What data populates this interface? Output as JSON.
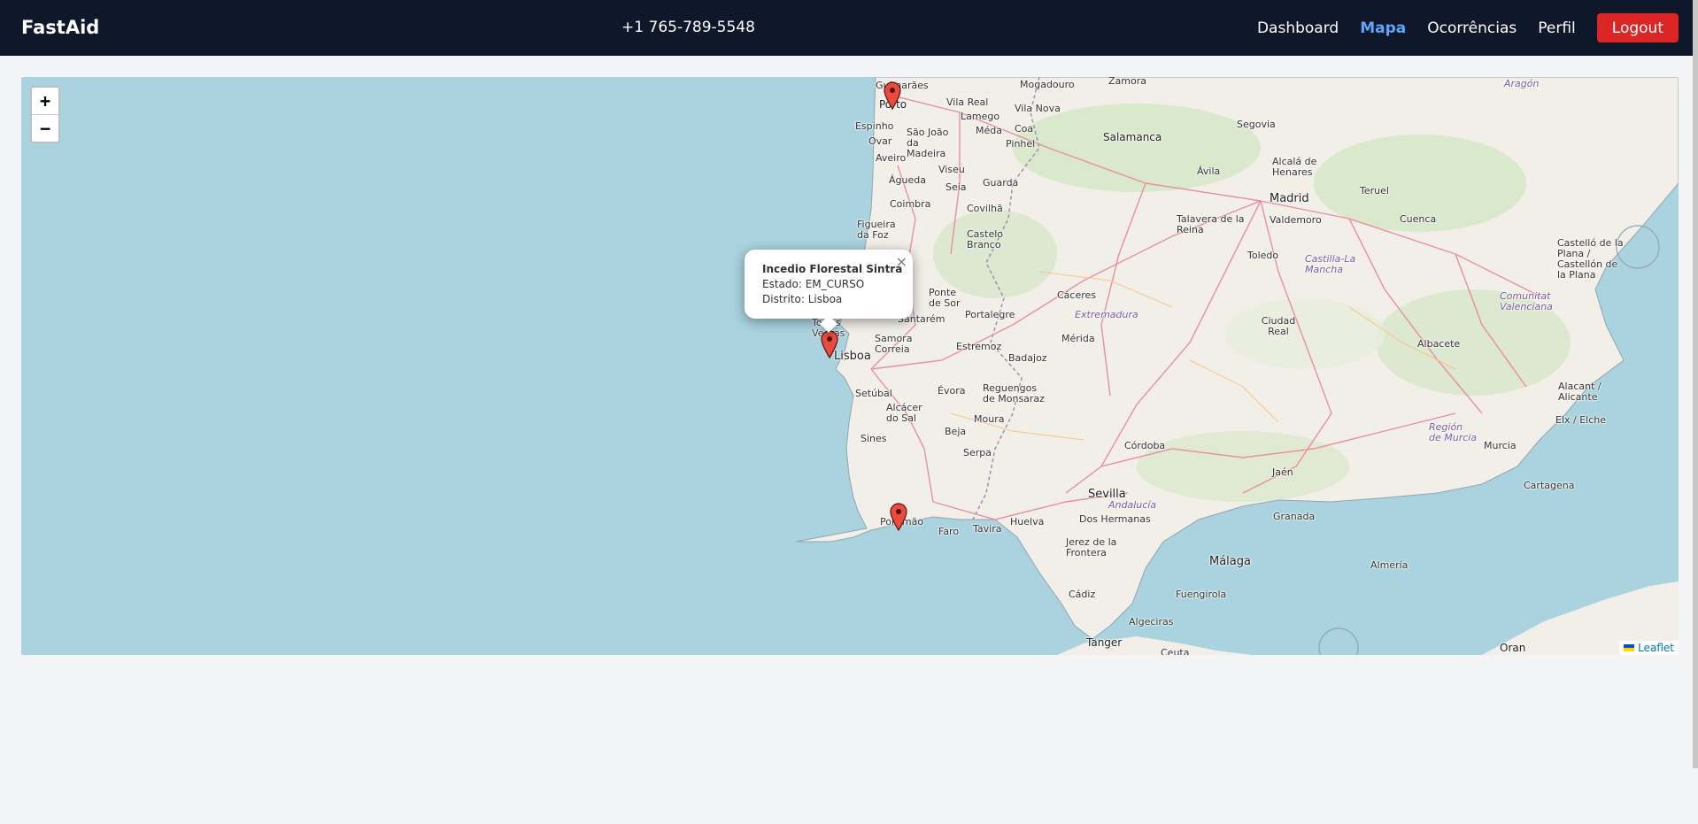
{
  "navbar": {
    "brand": "FastAid",
    "phone": "+1 765-789-5548",
    "links": [
      {
        "label": "Dashboard",
        "active": false
      },
      {
        "label": "Mapa",
        "active": true
      },
      {
        "label": "Ocorrências",
        "active": false
      },
      {
        "label": "Perfil",
        "active": false
      }
    ],
    "logout_label": "Logout"
  },
  "map": {
    "zoom_in_label": "+",
    "zoom_out_label": "−",
    "attribution": "Leaflet",
    "popup": {
      "title": "Incedio Florestal Sintra",
      "status": "Estado: EM_CURSO",
      "district": "Distrito: Lisboa",
      "close_label": "×"
    },
    "places": [
      "Guimarães",
      "Porto",
      "Vila Real",
      "Mogadouro",
      "Zamora",
      "Aragón",
      "Espinho",
      "São João da Madeira",
      "Lamego",
      "Vila Nova",
      "Ovar",
      "Méda",
      "Coa",
      "Salamanca",
      "Segovia",
      "Pinhel",
      "Aveiro",
      "Águeda",
      "Viseu",
      "Ávila",
      "Alcalá de Henares",
      "Madrid",
      "Seia",
      "Guarda",
      "Coimbra",
      "Covilhã",
      "Teruel",
      "Figueira da Foz",
      "Talavera de la Reina",
      "Valdemoro",
      "Cuenca",
      "Castelo Branco",
      "Toledo",
      "Castilla-La Mancha",
      "Castelló de la Plana / Castellón de la Plana",
      "Cáceres",
      "Ponte de Sor",
      "Comunitat Valenciana",
      "Santarém",
      "Portalegre",
      "Extremadura",
      "Torres Vedras",
      "Lisboa",
      "Samora Correia",
      "Estremoz",
      "Mérida",
      "Ciudad Real",
      "Albacete",
      "Badajoz",
      "Setúbal",
      "Évora",
      "Reguengos de Monsaraz",
      "Alacant / Alicante",
      "Alcácer do Sal",
      "Moura",
      "Elx / Elche",
      "Región de Murcia",
      "Beja",
      "Sines",
      "Serpa",
      "Córdoba",
      "Murcia",
      "Jaén",
      "Cartagena",
      "Sevilla",
      "Andalucía",
      "Portimão",
      "Faro",
      "Tavira",
      "Huelva",
      "Dos Hermanas",
      "Granada",
      "Jerez de la Frontera",
      "Málaga",
      "Almería",
      "Fuengirola",
      "Cádiz",
      "Algeciras",
      "Tanger",
      "Ceuta",
      "Oran"
    ]
  }
}
